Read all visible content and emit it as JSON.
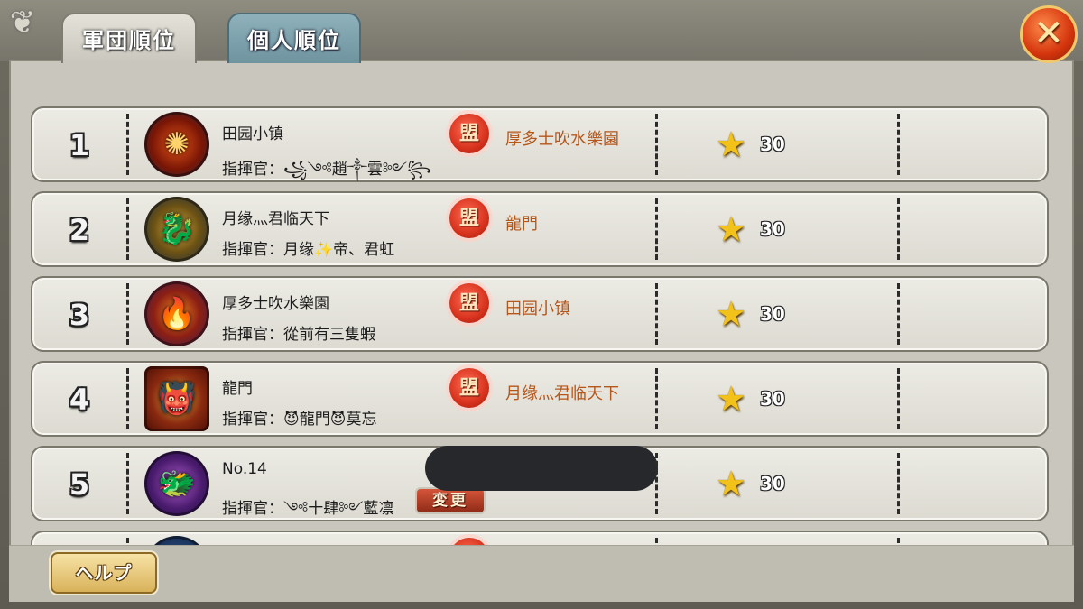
{
  "tabs": [
    {
      "label": "軍団順位",
      "active": true
    },
    {
      "label": "個人順位",
      "active": false
    }
  ],
  "close_icon": "close-x-icon",
  "rows": [
    {
      "rank": "1",
      "emblem": "phoenix-emblem-icon",
      "name": "田园小镇",
      "commander": "指揮官：꧁༺趙༒雲༻꧂",
      "ally_badge": "盟",
      "ally": "厚多士吹水樂園",
      "star_icon": "star-icon",
      "score": "30"
    },
    {
      "rank": "2",
      "emblem": "dragon-emblem-icon",
      "name": "月缘灬君临天下",
      "commander": "指揮官：月缘✨帝、君虹",
      "ally_badge": "盟",
      "ally": "龍門",
      "star_icon": "star-icon",
      "score": "30"
    },
    {
      "rank": "3",
      "emblem": "firebird-emblem-icon",
      "name": "厚多士吹水樂園",
      "commander": "指揮官：從前有三隻蝦",
      "ally_badge": "盟",
      "ally": "田园小镇",
      "star_icon": "star-icon",
      "score": "30"
    },
    {
      "rank": "4",
      "emblem": "beast-mask-emblem-icon",
      "name": "龍門",
      "commander": "指揮官：😈龍門😈莫忘",
      "ally_badge": "盟",
      "ally": "月缘灬君临天下",
      "star_icon": "star-icon",
      "score": "30"
    },
    {
      "rank": "5",
      "emblem": "purple-dragon-emblem-icon",
      "name": "No.14",
      "commander": "指揮官：༺十肆༻藍凛",
      "change_label": "変更",
      "star_icon": "star-icon",
      "score": "30"
    }
  ],
  "help_label": "ヘルプ",
  "colors": {
    "ally_text": "#b5561b",
    "tab_active": "#dcdad1",
    "tab_inactive": "#7fa3ad",
    "close": "#d4350d",
    "star": "#f2c21a"
  }
}
